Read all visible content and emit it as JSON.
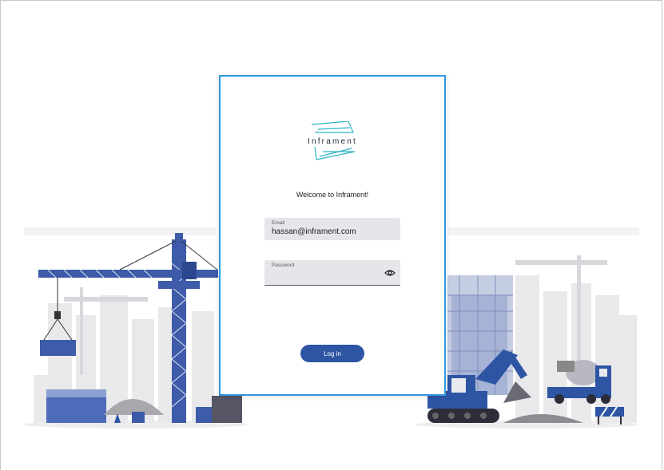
{
  "brand": {
    "name": "Inframent",
    "accent": "#2fb6c4",
    "primary": "#2d55a4",
    "card_border": "#2f97e0"
  },
  "login": {
    "welcome": "Welcome to Inframent!",
    "email": {
      "label": "Email",
      "value": "hassan@inframent.com"
    },
    "password": {
      "label": "Password",
      "value": "",
      "toggle_icon": "eye-icon"
    },
    "submit_label": "Log in"
  },
  "illustration": {
    "theme": "construction-site",
    "elements": [
      "tower-crane-icon",
      "excavator-icon",
      "cement-mixer-truck-icon",
      "road-barrier-icon",
      "city-skyline"
    ]
  }
}
